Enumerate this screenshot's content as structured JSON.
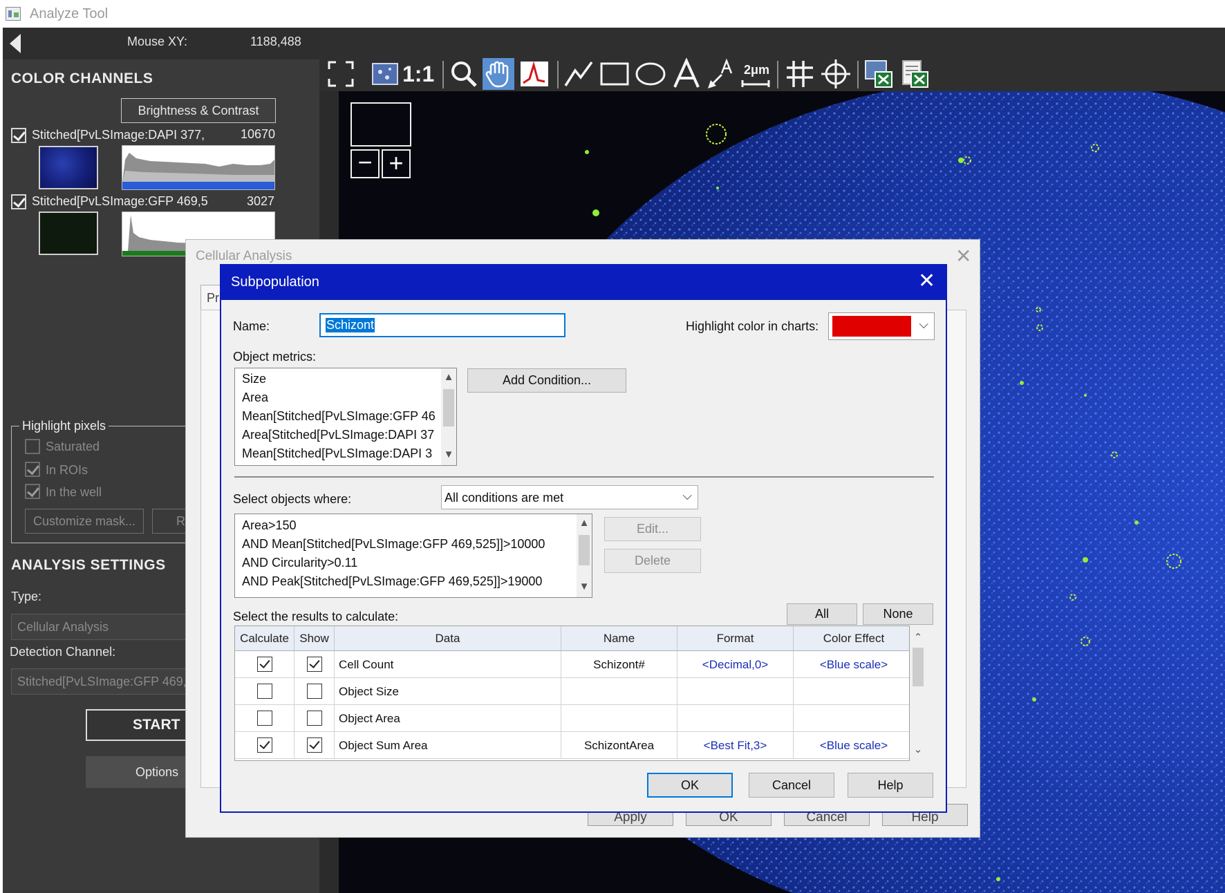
{
  "window": {
    "title": "Analyze Tool"
  },
  "left_panel": {
    "mouse_xy_label": "Mouse XY:",
    "mouse_xy_value": "1188,488",
    "color_channels": {
      "title": "COLOR CHANNELS",
      "brightness_button": "Brightness & Contrast",
      "channels": [
        {
          "label": "Stitched[PvLSImage:DAPI 377,",
          "max": "10670",
          "checked": true,
          "thumb_color": "#1b2a86",
          "hist_bar_color": "#2a5bd8"
        },
        {
          "label": "Stitched[PvLSImage:GFP 469,5",
          "max": "3027",
          "checked": true,
          "thumb_color": "#0f2010",
          "hist_bar_color": "#1c7a1c"
        }
      ]
    },
    "highlight_pixels": {
      "title": "Highlight pixels",
      "saturated": "Saturated",
      "in_rois": "In ROIs",
      "in_the_well": "In the well",
      "customize_mask": "Customize mask...",
      "r_fragment": "R"
    },
    "analysis_settings": {
      "title": "ANALYSIS SETTINGS",
      "type_label": "Type:",
      "type_value": "Cellular Analysis",
      "detection_label": "Detection Channel:",
      "detection_value": "Stitched[PvLSImage:GFP 469,",
      "start_button": "START",
      "options_button": "Options"
    }
  },
  "toolbar": {
    "one_to_one": "1:1",
    "scale_label": "2μm",
    "active_tool": "pan-hand"
  },
  "cellular_analysis": {
    "title": "Cellular Analysis",
    "tab_fragment": "Pr",
    "buttons": [
      "Apply",
      "OK",
      "Cancel",
      "Help"
    ]
  },
  "subpopulation": {
    "title": "Subpopulation",
    "name_label": "Name:",
    "name_value": "Schizont",
    "highlight_label": "Highlight color in charts:",
    "highlight_color": "#e00000",
    "object_metrics_label": "Object metrics:",
    "object_metrics": [
      "Size",
      "Area",
      "Mean[Stitched[PvLSImage:GFP 46",
      "Area[Stitched[PvLSImage:DAPI 37",
      "Mean[Stitched[PvLSImage:DAPI 3"
    ],
    "add_condition_button": "Add Condition...",
    "select_objects_label": "Select objects where:",
    "condition_mode": "All conditions are met",
    "conditions": [
      "Area>150",
      "AND Mean[Stitched[PvLSImage:GFP 469,525]]>10000",
      "AND Circularity>0.11",
      "AND Peak[Stitched[PvLSImage:GFP 469,525]]>19000"
    ],
    "edit_button": "Edit...",
    "delete_button": "Delete",
    "results_label": "Select the results to calculate:",
    "all_button": "All",
    "none_button": "None",
    "grid": {
      "headers": [
        "Calculate",
        "Show",
        "Data",
        "Name",
        "Format",
        "Color Effect"
      ],
      "rows": [
        {
          "calculate": true,
          "show": true,
          "data": "Cell Count",
          "name": "Schizont#",
          "format": "<Decimal,0>",
          "color_effect": "<Blue scale>"
        },
        {
          "calculate": false,
          "show": false,
          "data": "Object Size",
          "name": "",
          "format": "",
          "color_effect": ""
        },
        {
          "calculate": false,
          "show": false,
          "data": "Object Area",
          "name": "",
          "format": "",
          "color_effect": ""
        },
        {
          "calculate": true,
          "show": true,
          "data": "Object Sum Area",
          "name": "SchizontArea",
          "format": "<Best Fit,3>",
          "color_effect": "<Blue scale>"
        }
      ]
    },
    "ok_button": "OK",
    "cancel_button": "Cancel",
    "help_button": "Help"
  }
}
